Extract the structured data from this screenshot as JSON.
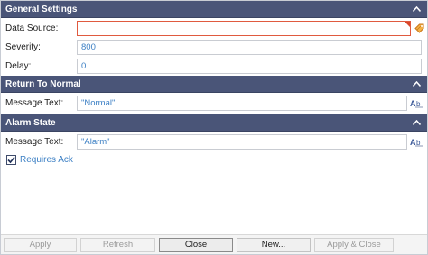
{
  "sections": {
    "general": {
      "title": "General Settings",
      "data_source_label": "Data Source:",
      "data_source_value": "",
      "severity_label": "Severity:",
      "severity_value": "800",
      "delay_label": "Delay:",
      "delay_value": "0"
    },
    "return_to_normal": {
      "title": "Return To Normal",
      "message_label": "Message Text:",
      "message_value": "\"Normal\""
    },
    "alarm_state": {
      "title": "Alarm State",
      "message_label": "Message Text:",
      "message_value": "\"Alarm\"",
      "requires_ack_label": "Requires Ack",
      "requires_ack_checked": true
    }
  },
  "footer": {
    "apply": "Apply",
    "refresh": "Refresh",
    "close": "Close",
    "new": "New...",
    "apply_close": "Apply & Close"
  },
  "colors": {
    "header_bg": "#4a5578",
    "link_text": "#3b7fc4",
    "error_border": "#e05a3f",
    "tag_icon": "#e8952e"
  },
  "icons": {
    "collapse": "chevron-up-icon",
    "tag_browse": "tag-browse-icon",
    "expression": "expression-icon",
    "check": "checkmark-icon"
  }
}
